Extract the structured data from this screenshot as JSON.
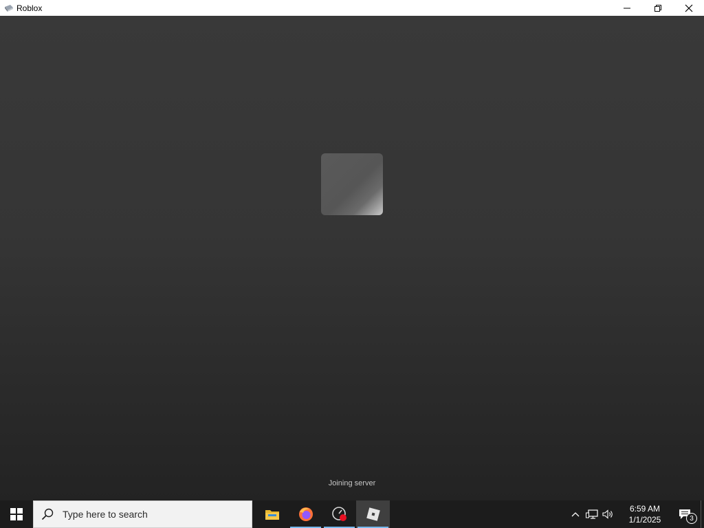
{
  "window": {
    "title": "Roblox",
    "app_icon": "roblox-app-icon",
    "controls": [
      "minimize-icon",
      "restore-icon",
      "close-icon"
    ]
  },
  "game": {
    "status_text": "Joining server",
    "loading_tile": "game-thumbnail-placeholder"
  },
  "taskbar": {
    "start_icon": "windows-logo-icon",
    "search": {
      "placeholder": "Type here to search",
      "icon": "search-icon"
    },
    "apps": [
      {
        "name": "File Explorer",
        "icon": "folder-icon",
        "running": false,
        "active": false
      },
      {
        "name": "Firefox",
        "icon": "firefox-icon",
        "running": true,
        "active": false
      },
      {
        "name": "Recorder",
        "icon": "record-gauge-icon",
        "running": true,
        "active": false
      },
      {
        "name": "Roblox",
        "icon": "roblox-icon",
        "running": true,
        "active": true
      }
    ],
    "tray": {
      "icons": [
        "chevron-up-icon",
        "network-icon",
        "volume-icon"
      ],
      "time": "6:59 AM",
      "date": "1/1/2025",
      "notification_count": "3"
    }
  },
  "colors": {
    "accent_underline": "#76b9ed",
    "taskbar_bg": "#1c1c1c",
    "game_bg_top": "#393939",
    "game_bg_bottom": "#232323"
  }
}
